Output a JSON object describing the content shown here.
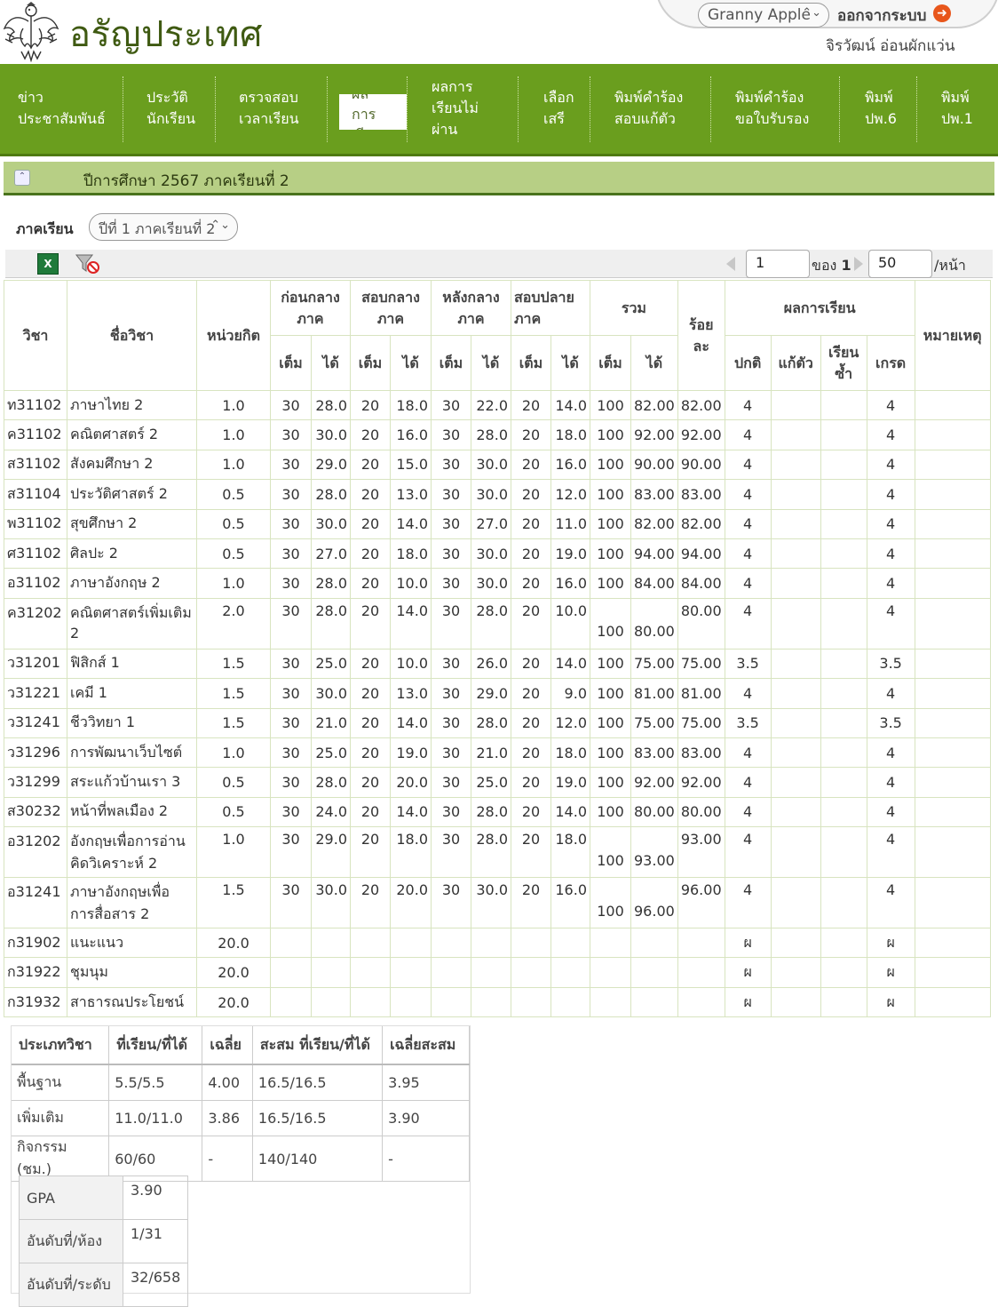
{
  "header": {
    "site_title": "อรัญประเทศ",
    "user_select": "Granny Apple",
    "logout": "ออกจากระบบ",
    "user_name": "จิรวัฒน์ อ่อนผักแว่น"
  },
  "nav": {
    "items": [
      {
        "label": "ข่าว\nประชาสัมพันธ์"
      },
      {
        "label": "ประวัติ\nนักเรียน"
      },
      {
        "label": "ตรวจสอบ\nเวลาเรียน"
      },
      {
        "label": "ผล\nการ\nเรียน"
      },
      {
        "label": "ผลการ\nเรียนไม่\nผ่าน"
      },
      {
        "label": "เลือก\nเสรี"
      },
      {
        "label": "พิมพ์คำร้อง\nสอบแก้ตัว"
      },
      {
        "label": "พิมพ์คำร้อง\nขอใบรับรอง"
      },
      {
        "label": "พิมพ์\nปพ.6"
      },
      {
        "label": "พิมพ์\nปพ.1"
      }
    ]
  },
  "section": {
    "title": "ปีการศึกษา 2567 ภาคเรียนที่ 2"
  },
  "term": {
    "label": "ภาคเรียน",
    "selected": "ปีที่ 1 ภาคเรียนที่ 2"
  },
  "pager": {
    "page": "1",
    "of_label": "ของ",
    "total": "1",
    "page_size": "50",
    "per_page": "/หน้า"
  },
  "grade_table": {
    "headers": {
      "code": "วิชา",
      "name": "ชื่อวิชา",
      "credit": "หน่วยกิต",
      "pre_mid": "ก่อนกลางภาค",
      "mid": "สอบกลางภาค",
      "post_mid": "หลังกลางภาค",
      "final": "สอบปลายภาค",
      "total": "รวม",
      "percent": "ร้อยละ",
      "result": "ผลการเรียน",
      "remark": "หมายเหตุ",
      "full": "เต็ม",
      "got": "ได้",
      "normal": "ปกติ",
      "retake": "แก้ตัว",
      "repeat": "เรียนซ้ำ",
      "grade": "เกรด"
    },
    "rows": [
      {
        "code": "ท31102",
        "name": "ภาษาไทย 2",
        "credit": "1.0",
        "f1": "30",
        "g1": "28.0",
        "f2": "20",
        "g2": "18.0",
        "f3": "30",
        "g3": "22.0",
        "f4": "20",
        "g4": "14.0",
        "tf": "100",
        "tg": "82.00",
        "pct": "82.00",
        "normal": "4",
        "retake": "",
        "repeat": "",
        "grade": "4",
        "tall": false
      },
      {
        "code": "ค31102",
        "name": "คณิตศาสตร์ 2",
        "credit": "1.0",
        "f1": "30",
        "g1": "30.0",
        "f2": "20",
        "g2": "16.0",
        "f3": "30",
        "g3": "28.0",
        "f4": "20",
        "g4": "18.0",
        "tf": "100",
        "tg": "92.00",
        "pct": "92.00",
        "normal": "4",
        "retake": "",
        "repeat": "",
        "grade": "4",
        "tall": false
      },
      {
        "code": "ส31102",
        "name": "สังคมศึกษา 2",
        "credit": "1.0",
        "f1": "30",
        "g1": "29.0",
        "f2": "20",
        "g2": "15.0",
        "f3": "30",
        "g3": "30.0",
        "f4": "20",
        "g4": "16.0",
        "tf": "100",
        "tg": "90.00",
        "pct": "90.00",
        "normal": "4",
        "retake": "",
        "repeat": "",
        "grade": "4",
        "tall": false
      },
      {
        "code": "ส31104",
        "name": "ประวัติศาสตร์ 2",
        "credit": "0.5",
        "f1": "30",
        "g1": "28.0",
        "f2": "20",
        "g2": "13.0",
        "f3": "30",
        "g3": "30.0",
        "f4": "20",
        "g4": "12.0",
        "tf": "100",
        "tg": "83.00",
        "pct": "83.00",
        "normal": "4",
        "retake": "",
        "repeat": "",
        "grade": "4",
        "tall": false
      },
      {
        "code": "พ31102",
        "name": "สุขศึกษา 2",
        "credit": "0.5",
        "f1": "30",
        "g1": "30.0",
        "f2": "20",
        "g2": "14.0",
        "f3": "30",
        "g3": "27.0",
        "f4": "20",
        "g4": "11.0",
        "tf": "100",
        "tg": "82.00",
        "pct": "82.00",
        "normal": "4",
        "retake": "",
        "repeat": "",
        "grade": "4",
        "tall": false
      },
      {
        "code": "ศ31102",
        "name": "ศิลปะ 2",
        "credit": "0.5",
        "f1": "30",
        "g1": "27.0",
        "f2": "20",
        "g2": "18.0",
        "f3": "30",
        "g3": "30.0",
        "f4": "20",
        "g4": "19.0",
        "tf": "100",
        "tg": "94.00",
        "pct": "94.00",
        "normal": "4",
        "retake": "",
        "repeat": "",
        "grade": "4",
        "tall": false
      },
      {
        "code": "อ31102",
        "name": "ภาษาอังกฤษ 2",
        "credit": "1.0",
        "f1": "30",
        "g1": "28.0",
        "f2": "20",
        "g2": "10.0",
        "f3": "30",
        "g3": "30.0",
        "f4": "20",
        "g4": "16.0",
        "tf": "100",
        "tg": "84.00",
        "pct": "84.00",
        "normal": "4",
        "retake": "",
        "repeat": "",
        "grade": "4",
        "tall": false
      },
      {
        "code": "ค31202",
        "name": "คณิตศาสตร์เพิ่มเติม 2",
        "credit": "2.0",
        "f1": "30",
        "g1": "28.0",
        "f2": "20",
        "g2": "14.0",
        "f3": "30",
        "g3": "28.0",
        "f4": "20",
        "g4": "10.0",
        "tf": "100",
        "tg": "80.00",
        "pct": "80.00",
        "normal": "4",
        "retake": "",
        "repeat": "",
        "grade": "4",
        "tall": true
      },
      {
        "code": "ว31201",
        "name": "ฟิสิกส์ 1",
        "credit": "1.5",
        "f1": "30",
        "g1": "25.0",
        "f2": "20",
        "g2": "10.0",
        "f3": "30",
        "g3": "26.0",
        "f4": "20",
        "g4": "14.0",
        "tf": "100",
        "tg": "75.00",
        "pct": "75.00",
        "normal": "3.5",
        "retake": "",
        "repeat": "",
        "grade": "3.5",
        "tall": false
      },
      {
        "code": "ว31221",
        "name": "เคมี 1",
        "credit": "1.5",
        "f1": "30",
        "g1": "30.0",
        "f2": "20",
        "g2": "13.0",
        "f3": "30",
        "g3": "29.0",
        "f4": "20",
        "g4": "9.0",
        "tf": "100",
        "tg": "81.00",
        "pct": "81.00",
        "normal": "4",
        "retake": "",
        "repeat": "",
        "grade": "4",
        "tall": false
      },
      {
        "code": "ว31241",
        "name": "ชีววิทยา 1",
        "credit": "1.5",
        "f1": "30",
        "g1": "21.0",
        "f2": "20",
        "g2": "14.0",
        "f3": "30",
        "g3": "28.0",
        "f4": "20",
        "g4": "12.0",
        "tf": "100",
        "tg": "75.00",
        "pct": "75.00",
        "normal": "3.5",
        "retake": "",
        "repeat": "",
        "grade": "3.5",
        "tall": false
      },
      {
        "code": "ว31296",
        "name": "การพัฒนาเว็บไซต์",
        "credit": "1.0",
        "f1": "30",
        "g1": "25.0",
        "f2": "20",
        "g2": "19.0",
        "f3": "30",
        "g3": "21.0",
        "f4": "20",
        "g4": "18.0",
        "tf": "100",
        "tg": "83.00",
        "pct": "83.00",
        "normal": "4",
        "retake": "",
        "repeat": "",
        "grade": "4",
        "tall": false
      },
      {
        "code": "ว31299",
        "name": "สระแก้วบ้านเรา 3",
        "credit": "0.5",
        "f1": "30",
        "g1": "28.0",
        "f2": "20",
        "g2": "20.0",
        "f3": "30",
        "g3": "25.0",
        "f4": "20",
        "g4": "19.0",
        "tf": "100",
        "tg": "92.00",
        "pct": "92.00",
        "normal": "4",
        "retake": "",
        "repeat": "",
        "grade": "4",
        "tall": false
      },
      {
        "code": "ส30232",
        "name": "หน้าที่พลเมือง 2",
        "credit": "0.5",
        "f1": "30",
        "g1": "24.0",
        "f2": "20",
        "g2": "14.0",
        "f3": "30",
        "g3": "28.0",
        "f4": "20",
        "g4": "14.0",
        "tf": "100",
        "tg": "80.00",
        "pct": "80.00",
        "normal": "4",
        "retake": "",
        "repeat": "",
        "grade": "4",
        "tall": false
      },
      {
        "code": "อ31202",
        "name": "อังกฤษเพื่อการอ่านคิดวิเคราะห์ 2",
        "credit": "1.0",
        "f1": "30",
        "g1": "29.0",
        "f2": "20",
        "g2": "18.0",
        "f3": "30",
        "g3": "28.0",
        "f4": "20",
        "g4": "18.0",
        "tf": "100",
        "tg": "93.00",
        "pct": "93.00",
        "normal": "4",
        "retake": "",
        "repeat": "",
        "grade": "4",
        "tall": true
      },
      {
        "code": "อ31241",
        "name": "ภาษาอังกฤษเพื่อการสื่อสาร 2",
        "credit": "1.5",
        "f1": "30",
        "g1": "30.0",
        "f2": "20",
        "g2": "20.0",
        "f3": "30",
        "g3": "30.0",
        "f4": "20",
        "g4": "16.0",
        "tf": "100",
        "tg": "96.00",
        "pct": "96.00",
        "normal": "4",
        "retake": "",
        "repeat": "",
        "grade": "4",
        "tall": true
      },
      {
        "code": "ก31902",
        "name": "แนะแนว",
        "credit": "20.0",
        "f1": "",
        "g1": "",
        "f2": "",
        "g2": "",
        "f3": "",
        "g3": "",
        "f4": "",
        "g4": "",
        "tf": "",
        "tg": "",
        "pct": "",
        "normal": "ผ",
        "retake": "",
        "repeat": "",
        "grade": "ผ",
        "tall": false
      },
      {
        "code": "ก31922",
        "name": "ชุมนุม",
        "credit": "20.0",
        "f1": "",
        "g1": "",
        "f2": "",
        "g2": "",
        "f3": "",
        "g3": "",
        "f4": "",
        "g4": "",
        "tf": "",
        "tg": "",
        "pct": "",
        "normal": "ผ",
        "retake": "",
        "repeat": "",
        "grade": "ผ",
        "tall": false
      },
      {
        "code": "ก31932",
        "name": "สาธารณประโยชน์",
        "credit": "20.0",
        "f1": "",
        "g1": "",
        "f2": "",
        "g2": "",
        "f3": "",
        "g3": "",
        "f4": "",
        "g4": "",
        "tf": "",
        "tg": "",
        "pct": "",
        "normal": "ผ",
        "retake": "",
        "repeat": "",
        "grade": "ผ",
        "tall": false
      }
    ]
  },
  "summary": {
    "headers": [
      "ประเภทวิชา",
      "ที่เรียน/ที่ได้",
      "เฉลี่ย",
      "สะสม ที่เรียน/ที่ได้",
      "เฉลี่ยสะสม"
    ],
    "rows": [
      [
        "พื้นฐาน",
        "5.5/5.5",
        "4.00",
        "16.5/16.5",
        "3.95"
      ],
      [
        "เพิ่มเติม",
        "11.0/11.0",
        "3.86",
        "16.5/16.5",
        "3.90"
      ],
      [
        "กิจกรรม (ชม.)",
        "60/60",
        "-",
        "140/140",
        "-"
      ]
    ],
    "gpa_label": "GPA",
    "gpa_value": "3.90",
    "class_rank_label": "อันดับที่/ห้อง",
    "class_rank_value": "1/31",
    "level_rank_label": "อันดับที่/ระดับ",
    "level_rank_value": "32/658"
  }
}
